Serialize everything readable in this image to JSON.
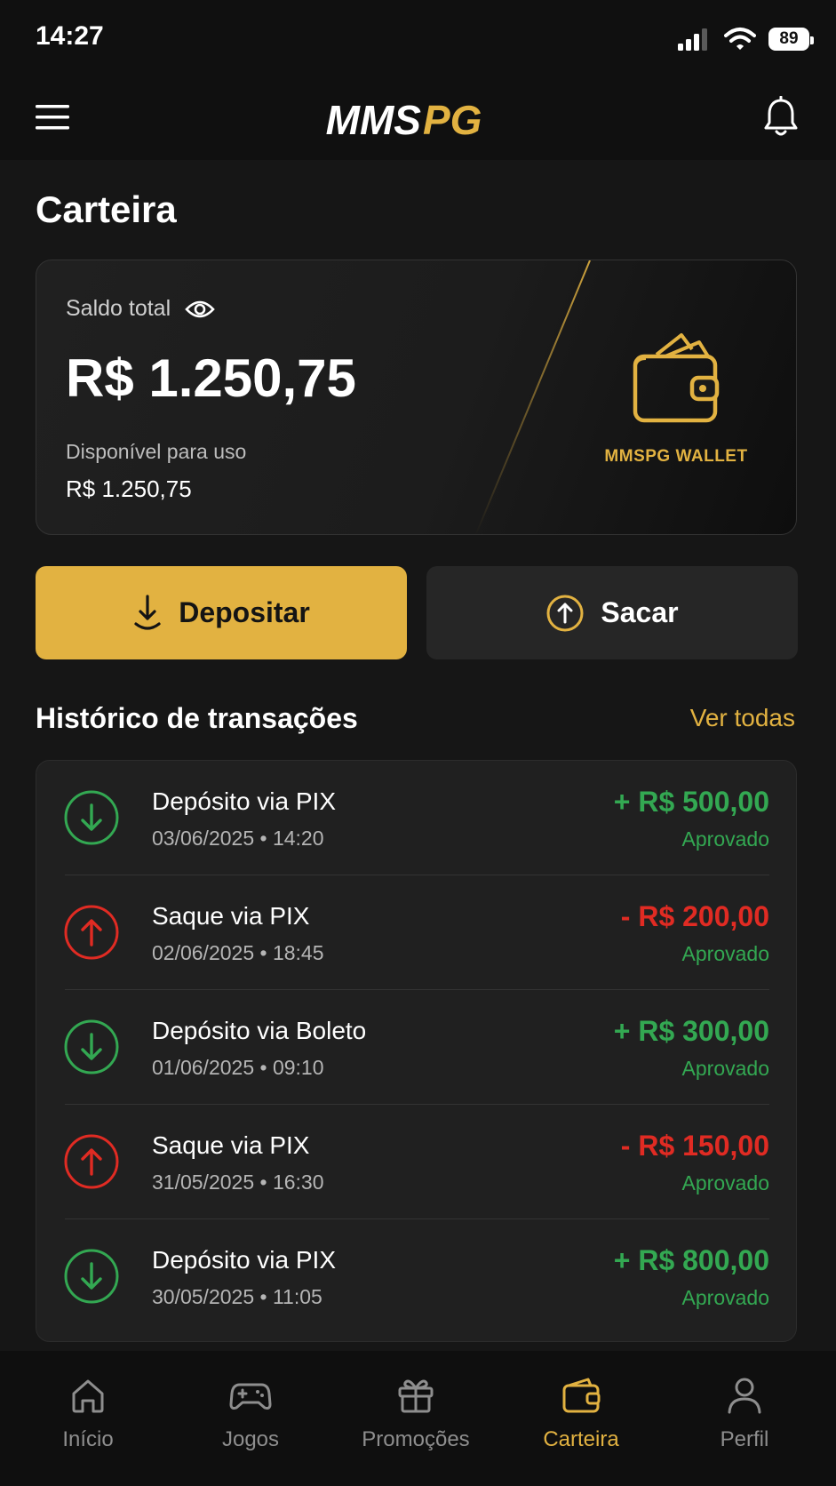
{
  "status_bar": {
    "time": "14:27",
    "battery": "89"
  },
  "header": {
    "logo_text_white": "MMS",
    "logo_text_gold": "PG"
  },
  "page": {
    "title": "Carteira"
  },
  "balance_card": {
    "saldo_label": "Saldo total",
    "saldo_value": "R$ 1.250,75",
    "available_label": "Disponível para uso",
    "available_value": "R$ 1.250,75",
    "wallet_brand": "MMSPG WALLET"
  },
  "actions": {
    "deposit_label": "Depositar",
    "withdraw_label": "Sacar"
  },
  "history": {
    "title": "Histórico de transações",
    "see_all": "Ver todas",
    "transactions": [
      {
        "type": "deposit",
        "title": "Depósito via PIX",
        "date": "03/06/2025 • 14:20",
        "amount": "+ R$ 500,00",
        "status": "Aprovado"
      },
      {
        "type": "withdraw",
        "title": "Saque via PIX",
        "date": "02/06/2025 • 18:45",
        "amount": "- R$ 200,00",
        "status": "Aprovado"
      },
      {
        "type": "deposit",
        "title": "Depósito via Boleto",
        "date": "01/06/2025 • 09:10",
        "amount": "+ R$ 300,00",
        "status": "Aprovado"
      },
      {
        "type": "withdraw",
        "title": "Saque via PIX",
        "date": "31/05/2025 • 16:30",
        "amount": "- R$ 150,00",
        "status": "Aprovado"
      },
      {
        "type": "deposit",
        "title": "Depósito via PIX",
        "date": "30/05/2025 • 11:05",
        "amount": "+ R$ 800,00",
        "status": "Aprovado"
      }
    ]
  },
  "bottom_nav": {
    "items": [
      {
        "label": "Início",
        "icon": "home-icon"
      },
      {
        "label": "Jogos",
        "icon": "gamepad-icon"
      },
      {
        "label": "Promoções",
        "icon": "gift-icon"
      },
      {
        "label": "Carteira",
        "icon": "wallet-icon",
        "active": true
      },
      {
        "label": "Perfil",
        "icon": "user-icon"
      }
    ]
  },
  "colors": {
    "accent": "#e2b241",
    "positive": "#33a852",
    "negative": "#e02b23",
    "background": "#161616"
  }
}
